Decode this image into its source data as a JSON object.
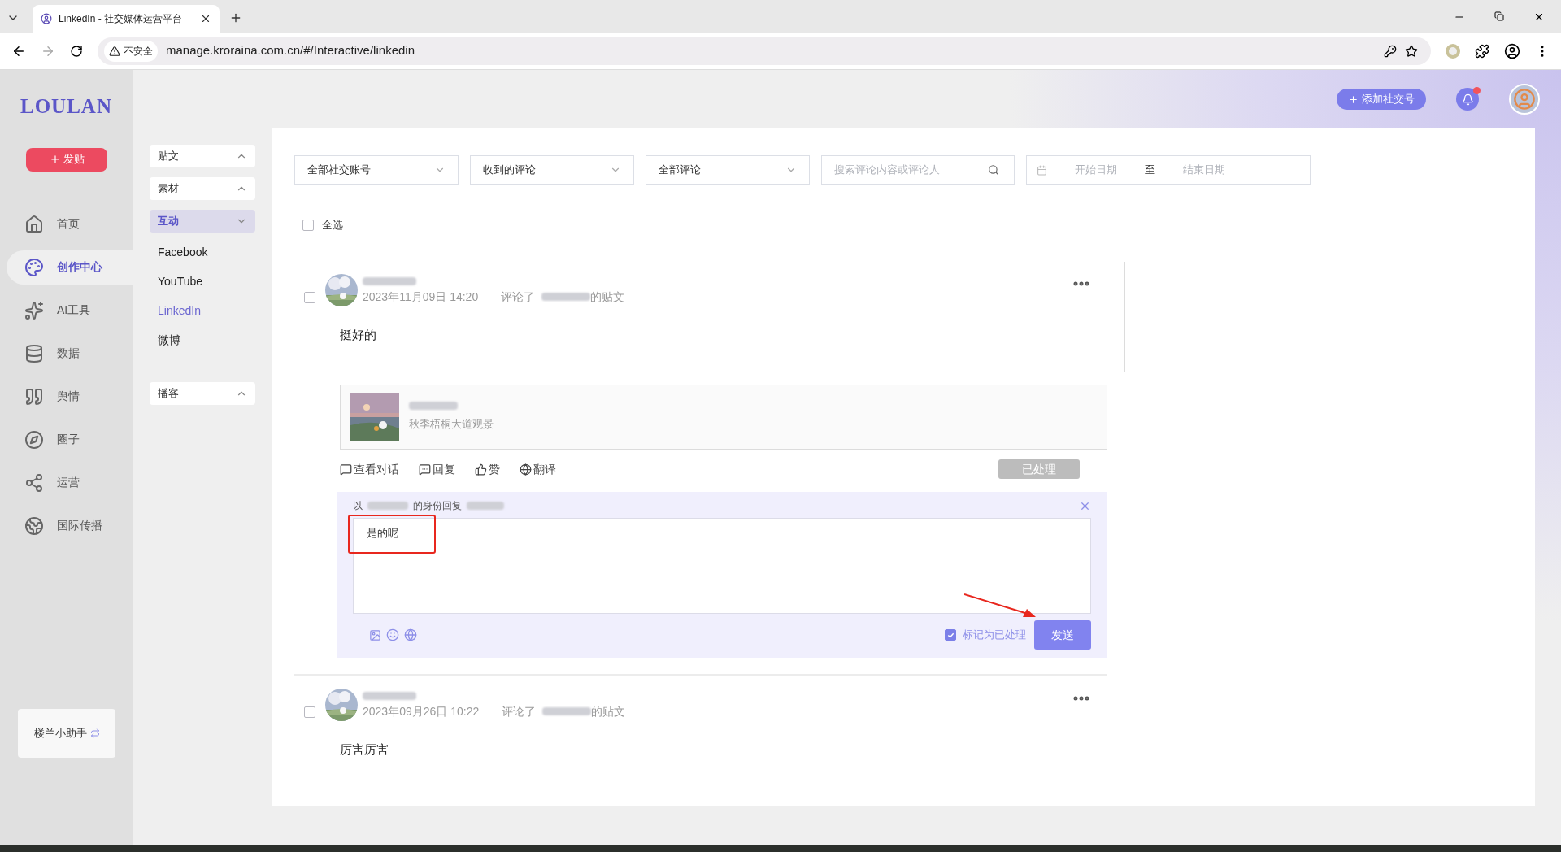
{
  "browser": {
    "tab_title": "LinkedIn - 社交媒体运营平台",
    "security": "不安全",
    "url": "manage.kroraina.com.cn/#/Interactive/linkedin"
  },
  "sidebar": {
    "logo": "LOULAN",
    "post_button": "发贴",
    "items": [
      {
        "label": "首页",
        "selected": false
      },
      {
        "label": "创作中心",
        "selected": true
      },
      {
        "label": "AI工具",
        "selected": false
      },
      {
        "label": "数据",
        "selected": false
      },
      {
        "label": "舆情",
        "selected": false
      },
      {
        "label": "圈子",
        "selected": false
      },
      {
        "label": "运营",
        "selected": false
      },
      {
        "label": "国际传播",
        "selected": false
      }
    ],
    "assistant": "楼兰小助手"
  },
  "submenu": [
    {
      "label": "贴文",
      "selected": false,
      "expanded": false
    },
    {
      "label": "素材",
      "selected": false,
      "expanded": false
    },
    {
      "label": "互动",
      "selected": true,
      "expanded": true,
      "children": [
        {
          "label": "Facebook",
          "selected": false
        },
        {
          "label": "YouTube",
          "selected": false
        },
        {
          "label": "LinkedIn",
          "selected": true
        },
        {
          "label": "微博",
          "selected": false
        }
      ]
    },
    {
      "label": "播客",
      "selected": false,
      "expanded": false
    }
  ],
  "header": {
    "add_button": "添加社交号",
    "has_unread": true
  },
  "filters": {
    "selects": [
      "全部社交账号",
      "收到的评论",
      "全部评论"
    ],
    "search_placeholder": "搜索评论内容或评论人",
    "start_placeholder": "开始日期",
    "separator": "至",
    "end_placeholder": "结束日期"
  },
  "select_all": {
    "label": "全选",
    "checked": false
  },
  "comments": [
    {
      "checked": false,
      "date": "2023年11月09日 14:20",
      "action": "评论了",
      "post_suffix": "的贴文",
      "text": "挺好的",
      "post_card": {
        "caption": "秋季梧桐大道观景"
      },
      "actions": [
        "查看对话",
        "回复",
        "赞",
        "翻译"
      ],
      "status_button": "已处理",
      "reply": {
        "prefix": "以",
        "middle": "的身份回复",
        "text": "是的呢",
        "mark": {
          "label": "标记为已处理",
          "checked": true
        },
        "send": "发送"
      }
    },
    {
      "checked": false,
      "date": "2023年09月26日 10:22",
      "action": "评论了",
      "post_suffix": "的贴文",
      "text": "厉害厉害"
    }
  ]
}
